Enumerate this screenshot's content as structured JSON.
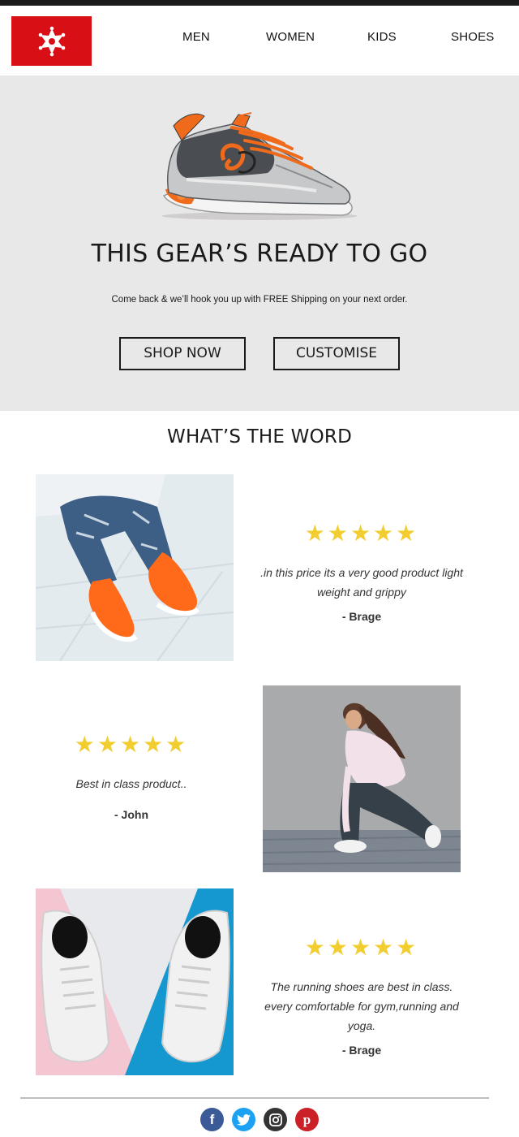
{
  "nav": {
    "logo_icon": "sheriff-star-icon",
    "items": [
      "MEN",
      "WOMEN",
      "KIDS",
      "SHOES"
    ]
  },
  "hero": {
    "title": "THIS GEAR’S READY TO GO",
    "subtitle": "Come back & we’ll hook you up with FREE Shipping on your next order.",
    "shop_label": "SHOP NOW",
    "customise_label": "CUSTOMISE"
  },
  "reviews_title": "WHAT’S THE WORD",
  "reviews": [
    {
      "rating": 5,
      "stars": "★★★★★",
      "text": ".in this price its a very good product light weight and grippy",
      "author": "- Brage"
    },
    {
      "rating": 5,
      "stars": "★★★★★",
      "text": "Best in class product..",
      "author": "- John"
    },
    {
      "rating": 5,
      "stars": "★★★★★",
      "text": "The running shoes are best in class. every comfortable for gym,running and yoga.",
      "author": "- Brage"
    }
  ],
  "social": [
    {
      "name": "facebook-icon",
      "glyph": "f"
    },
    {
      "name": "twitter-icon",
      "glyph": ""
    },
    {
      "name": "instagram-icon",
      "glyph": ""
    },
    {
      "name": "pinterest-icon",
      "glyph": "p"
    }
  ],
  "colors": {
    "brand_red": "#d90f16",
    "hero_bg": "#e9e8e8",
    "star": "#f2cd2f",
    "facebook": "#3a5a98",
    "twitter": "#1da1f2",
    "instagram": "#333333",
    "pinterest": "#cb2027"
  }
}
